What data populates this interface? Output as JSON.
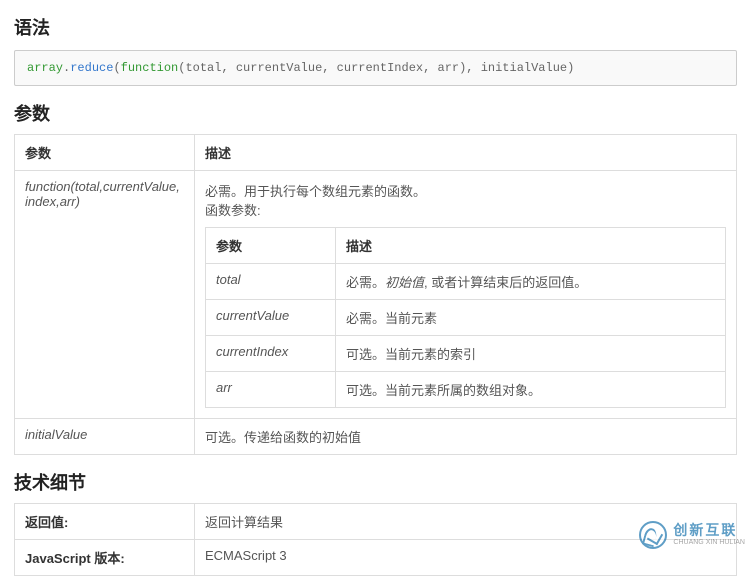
{
  "sections": {
    "syntax_heading": "语法",
    "params_heading": "参数",
    "tech_heading": "技术细节"
  },
  "code": {
    "obj": "array",
    "dot": ".",
    "method": "reduce",
    "open": "(",
    "fn_kw": "function",
    "args": "(total, currentValue, currentIndex, arr), initialValue",
    "close": ")"
  },
  "params_header": {
    "col1": "参数",
    "col2": "描述"
  },
  "row_function": {
    "name": "function(total,currentValue, index,arr)",
    "desc_line1": "必需。用于执行每个数组元素的函数。",
    "desc_line2": "函数参数:",
    "inner_header": {
      "col1": "参数",
      "col2": "描述"
    },
    "inner": [
      {
        "name": "total",
        "desc_prefix": "必需。",
        "desc_italic": "初始值",
        "desc_suffix": ", 或者计算结束后的返回值。"
      },
      {
        "name": "currentValue",
        "desc": "必需。当前元素"
      },
      {
        "name": "currentIndex",
        "desc": "可选。当前元素的索引"
      },
      {
        "name": "arr",
        "desc": "可选。当前元素所属的数组对象。"
      }
    ]
  },
  "row_initial": {
    "name": "initialValue",
    "desc": "可选。传递给函数的初始值"
  },
  "tech": {
    "return_label": "返回值:",
    "return_value": "返回计算结果",
    "version_label": "JavaScript 版本:",
    "version_value": "ECMAScript 3"
  },
  "watermark": {
    "cn": "创新互联",
    "en": "CHUANG XIN HULIAN"
  }
}
